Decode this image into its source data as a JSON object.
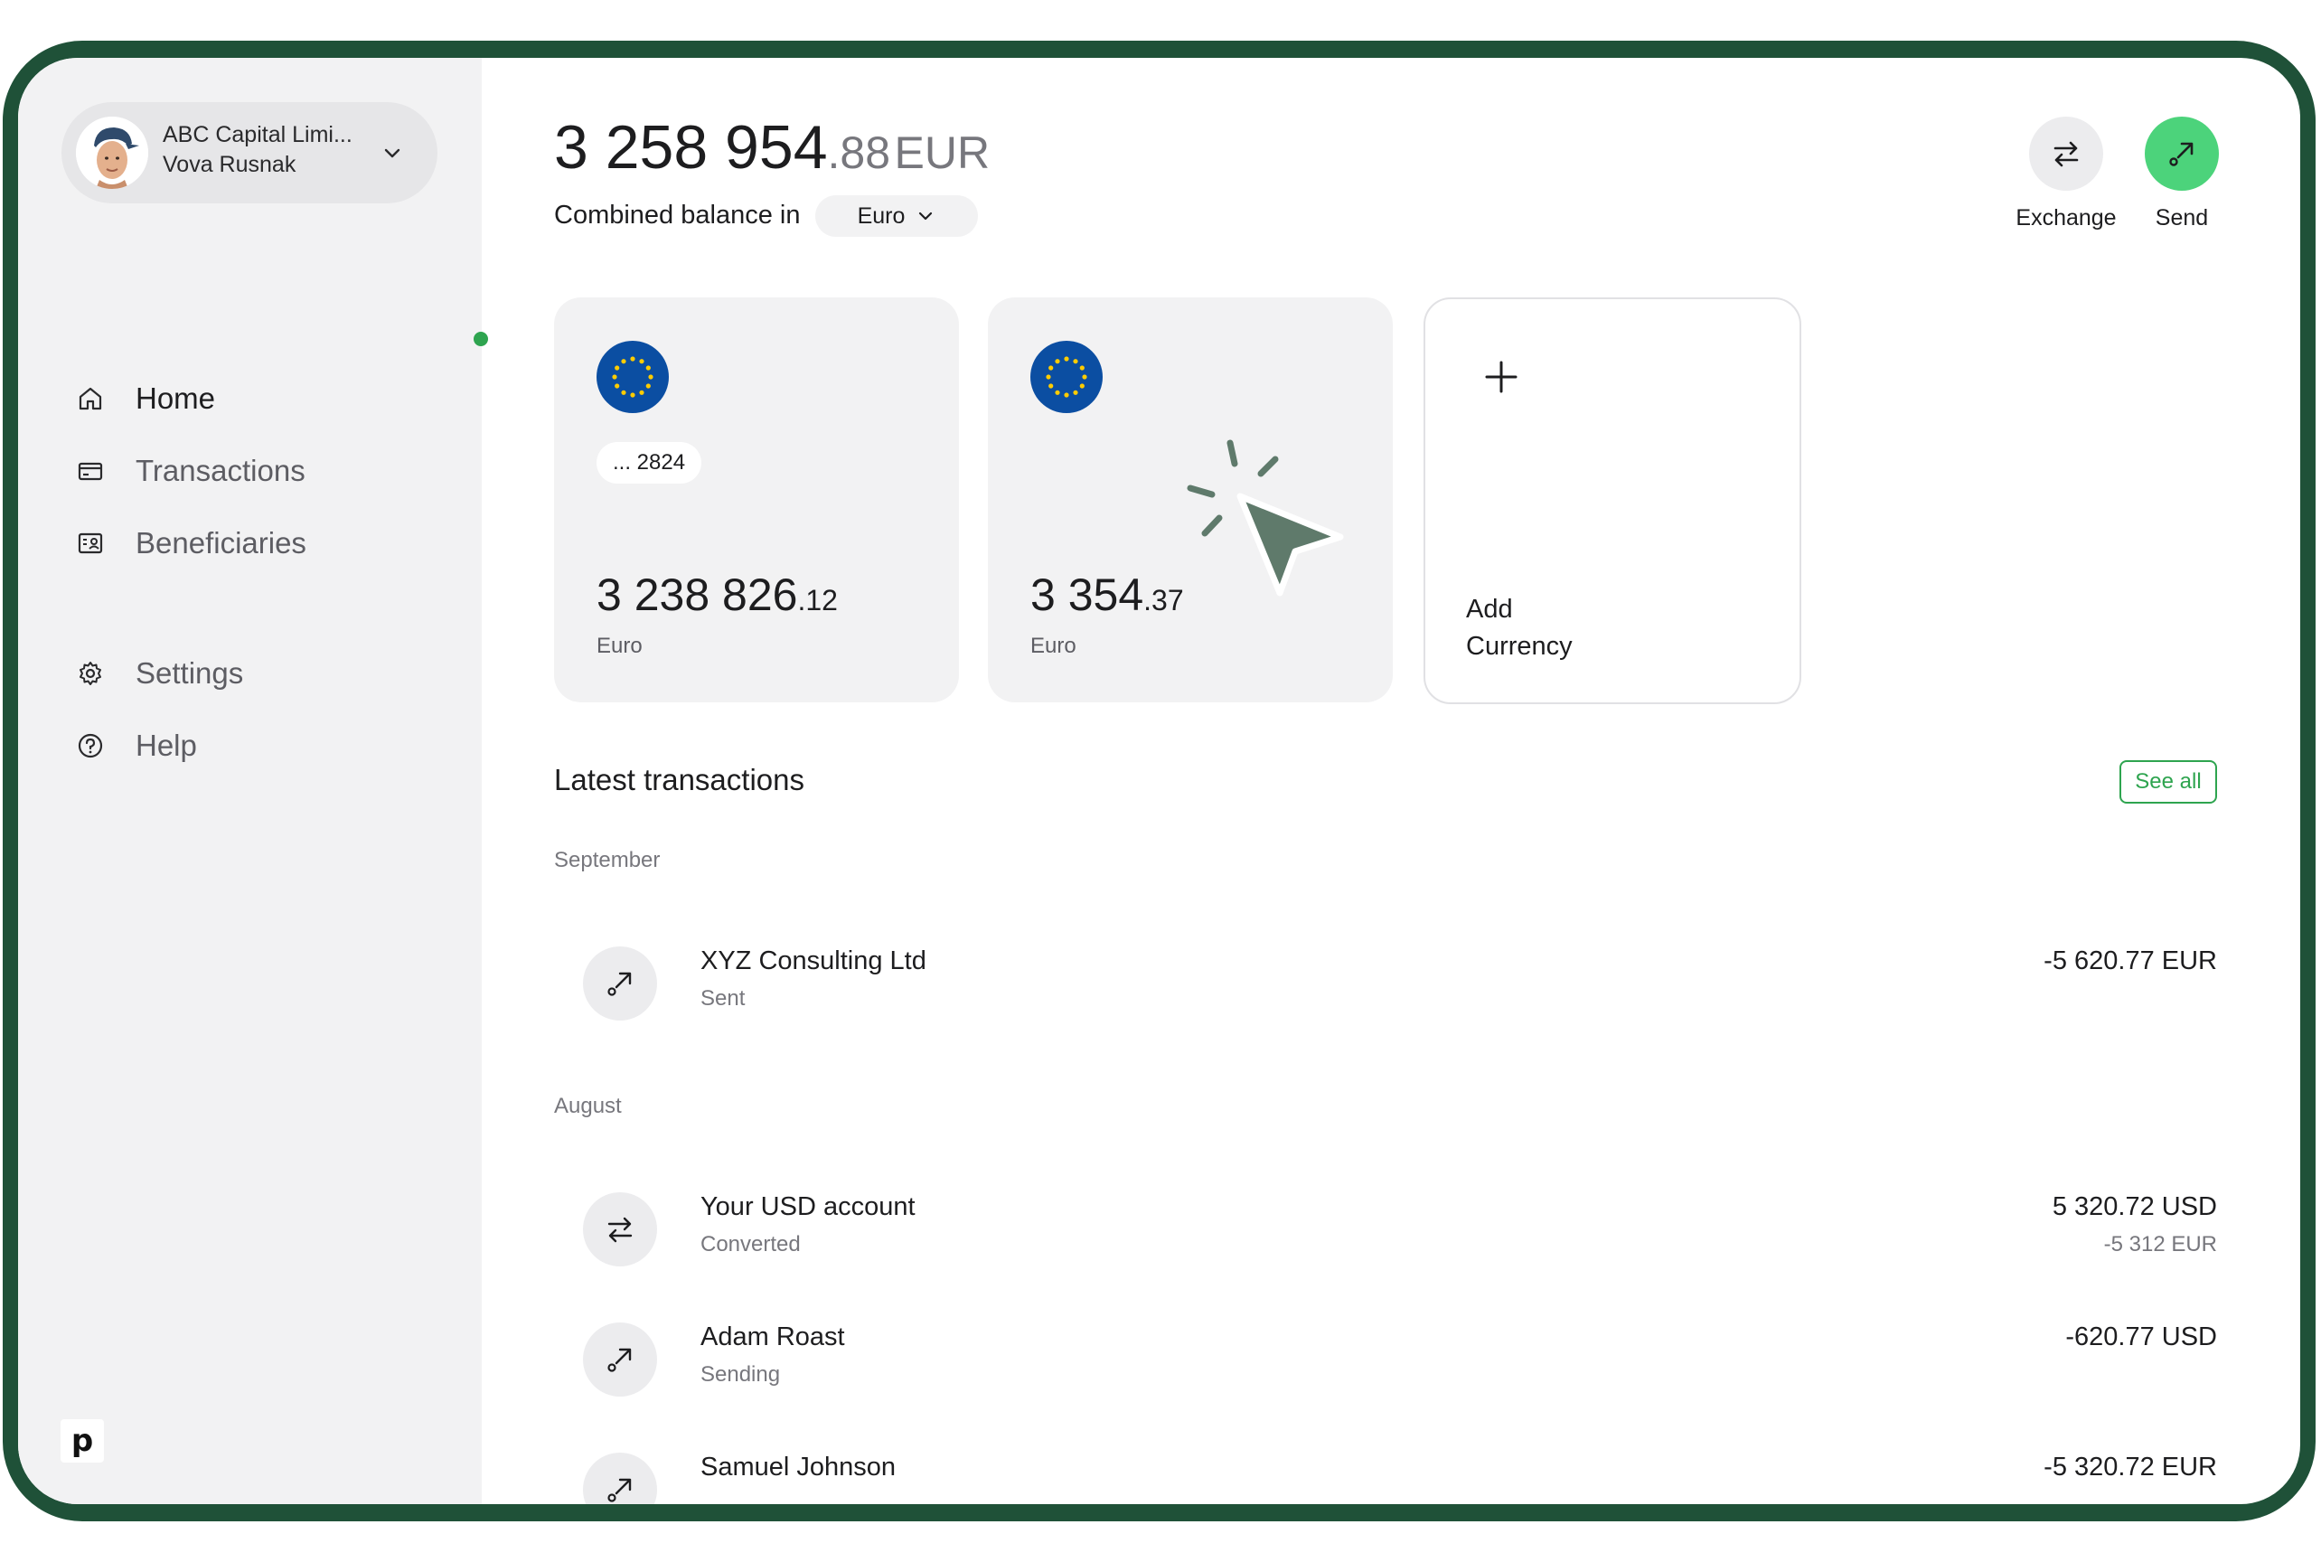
{
  "account": {
    "company": "ABC Capital Limi...",
    "user": "Vova Rusnak"
  },
  "nav": {
    "items": [
      {
        "label": "Home",
        "icon": "home-icon",
        "active": true
      },
      {
        "label": "Transactions",
        "icon": "card-icon",
        "active": false
      },
      {
        "label": "Beneficiaries",
        "icon": "contacts-icon",
        "active": false
      },
      {
        "label": "Settings",
        "icon": "gear-icon",
        "active": false
      },
      {
        "label": "Help",
        "icon": "help-icon",
        "active": false
      }
    ]
  },
  "brand": {
    "logo_letter": "p"
  },
  "balance": {
    "integer": "3 258 954",
    "fraction": ".88",
    "currency": "EUR",
    "combined_label": "Combined balance in",
    "selected_currency": "Euro"
  },
  "actions": {
    "exchange_label": "Exchange",
    "send_label": "Send"
  },
  "cards": [
    {
      "tag": "... 2824",
      "amount_int": "3 238 826",
      "amount_frac": ".12",
      "currency": "Euro"
    },
    {
      "tag": "",
      "amount_int": "3 354",
      "amount_frac": ".37",
      "currency": "Euro"
    }
  ],
  "add_currency": {
    "line1": "Add",
    "line2": "Currency"
  },
  "transactions": {
    "title": "Latest transactions",
    "see_all": "See all",
    "groups": [
      {
        "month": "September",
        "items": [
          {
            "name": "XYZ Consulting Ltd",
            "status": "Sent",
            "amount": "-5 620.77 EUR",
            "sub": "",
            "icon": "send-arrow-icon"
          }
        ]
      },
      {
        "month": "August",
        "items": [
          {
            "name": "Your USD account",
            "status": "Converted",
            "amount": "5 320.72 USD",
            "sub": "-5 312 EUR",
            "icon": "exchange-icon"
          },
          {
            "name": "Adam Roast",
            "status": "Sending",
            "amount": "-620.77 USD",
            "sub": "",
            "icon": "send-arrow-icon"
          },
          {
            "name": "Samuel Johnson",
            "status": "",
            "amount": "-5 320.72 EUR",
            "sub": "",
            "icon": "send-arrow-icon"
          }
        ]
      }
    ]
  },
  "colors": {
    "frame": "#1f5138",
    "accent_green": "#2ea44f",
    "send_button": "#4cd37b",
    "eu_blue": "#0b4ea2",
    "eu_star": "#ffcc00",
    "cursor": "#5f7a6b"
  }
}
